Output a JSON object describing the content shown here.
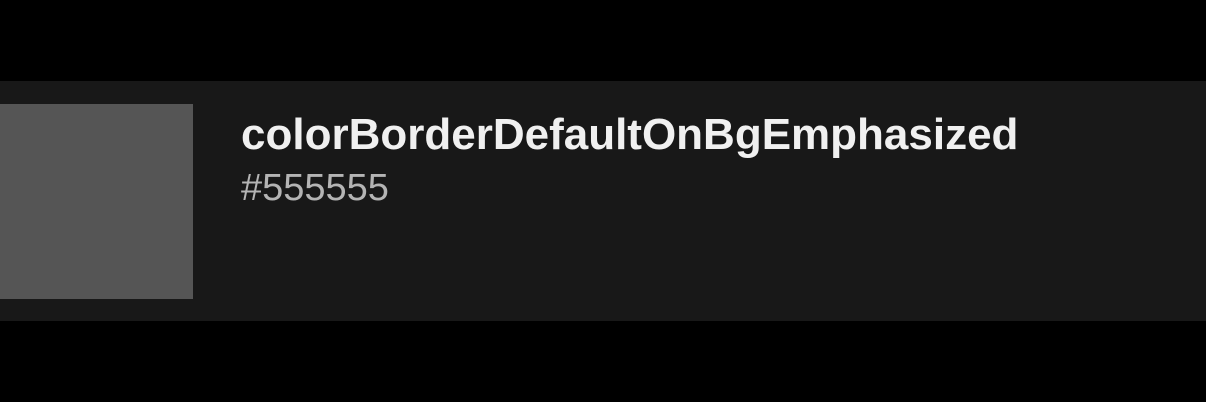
{
  "token": {
    "name": "colorBorderDefaultOnBgEmphasized",
    "value": "#555555",
    "swatch_color": "#555555"
  },
  "colors": {
    "page_background": "#000000",
    "row_background": "#181818",
    "name_text": "#f0f0f0",
    "value_text": "#b4b4b4"
  }
}
